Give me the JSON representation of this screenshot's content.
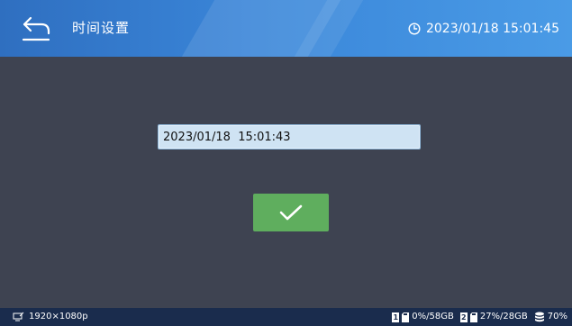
{
  "header": {
    "title": "时间设置",
    "clock_text": "2023/01/18 15:01:45",
    "icons": {
      "back": "back-arrow-icon",
      "clock": "clock-icon"
    }
  },
  "main": {
    "datetime_value": "2023/01/18  15:01:43",
    "confirm_icon": "checkmark-icon"
  },
  "status_bar": {
    "resolution": "1920×1080p",
    "disk1_label": "1",
    "disk1_usage": "0%/58GB",
    "disk2_label": "2",
    "disk2_usage": "27%/28GB",
    "storage_usage": "70%",
    "icons": {
      "resolution": "display-resolution-icon",
      "disk": "sd-card-icon",
      "storage": "database-icon"
    }
  },
  "colors": {
    "header_start": "#2f6fc0",
    "header_end": "#4a9be6",
    "background": "#3e4351",
    "confirm_green": "#5fae5e",
    "status_bar": "#1a2c4d",
    "input_bg": "#cfe3f3"
  }
}
